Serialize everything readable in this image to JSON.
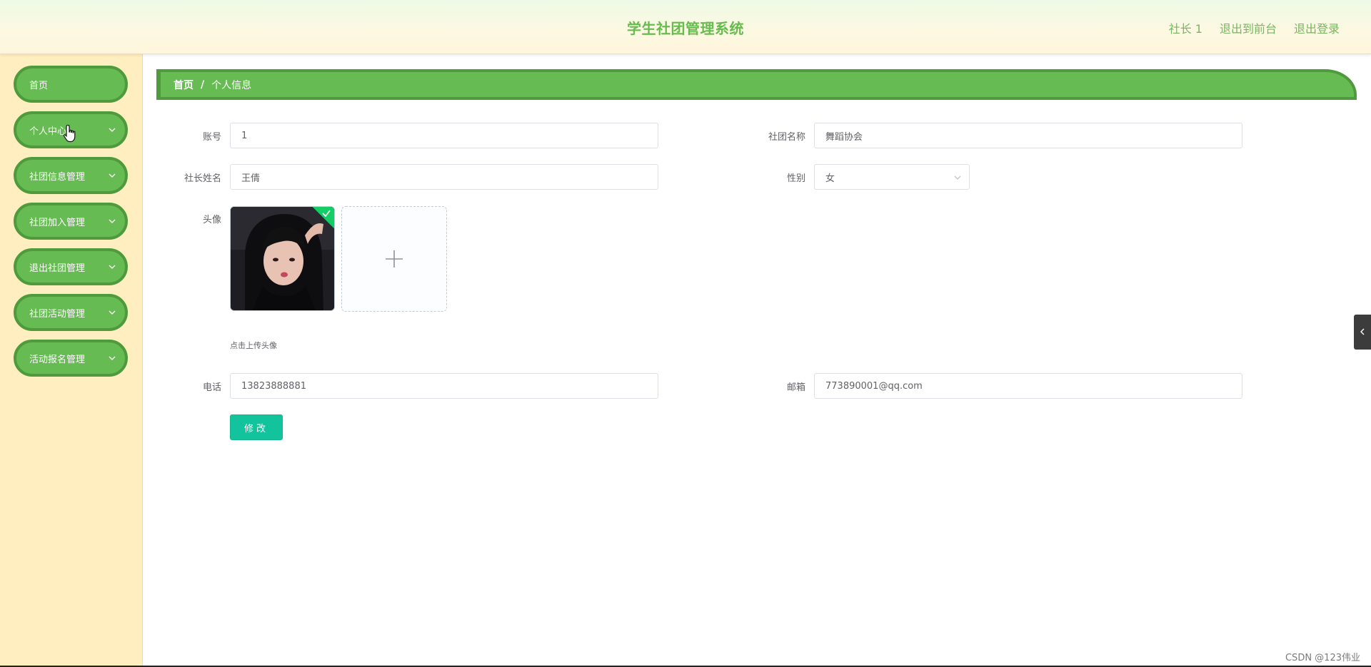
{
  "header": {
    "title": "学生社团管理系统",
    "user_label": "社长 1",
    "front_label": "退出到前台",
    "logout_label": "退出登录"
  },
  "sidebar": {
    "items": [
      {
        "label": "首页",
        "has_submenu": false
      },
      {
        "label": "个人中心",
        "has_submenu": true
      },
      {
        "label": "社团信息管理",
        "has_submenu": true
      },
      {
        "label": "社团加入管理",
        "has_submenu": true
      },
      {
        "label": "退出社团管理",
        "has_submenu": true
      },
      {
        "label": "社团活动管理",
        "has_submenu": true
      },
      {
        "label": "活动报名管理",
        "has_submenu": true
      }
    ]
  },
  "breadcrumb": {
    "home": "首页",
    "separator": "/",
    "current": "个人信息"
  },
  "form": {
    "account_label": "账号",
    "account_value": "1",
    "club_name_label": "社团名称",
    "club_name_value": "舞蹈协会",
    "leader_name_label": "社长姓名",
    "leader_name_value": "王倩",
    "gender_label": "性别",
    "gender_value": "女",
    "avatar_label": "头像",
    "upload_tip": "点击上传头像",
    "phone_label": "电话",
    "phone_value": "13823888881",
    "email_label": "邮箱",
    "email_value": "773890001@qq.com",
    "submit_label": "修改"
  },
  "watermark": "CSDN @123伟业",
  "colors": {
    "primary_green": "#66bb52",
    "dark_green": "#4e9a3c",
    "sidebar_bg": "#ffefc0",
    "submit_teal": "#13c39b",
    "title_green": "#67bb4f"
  }
}
